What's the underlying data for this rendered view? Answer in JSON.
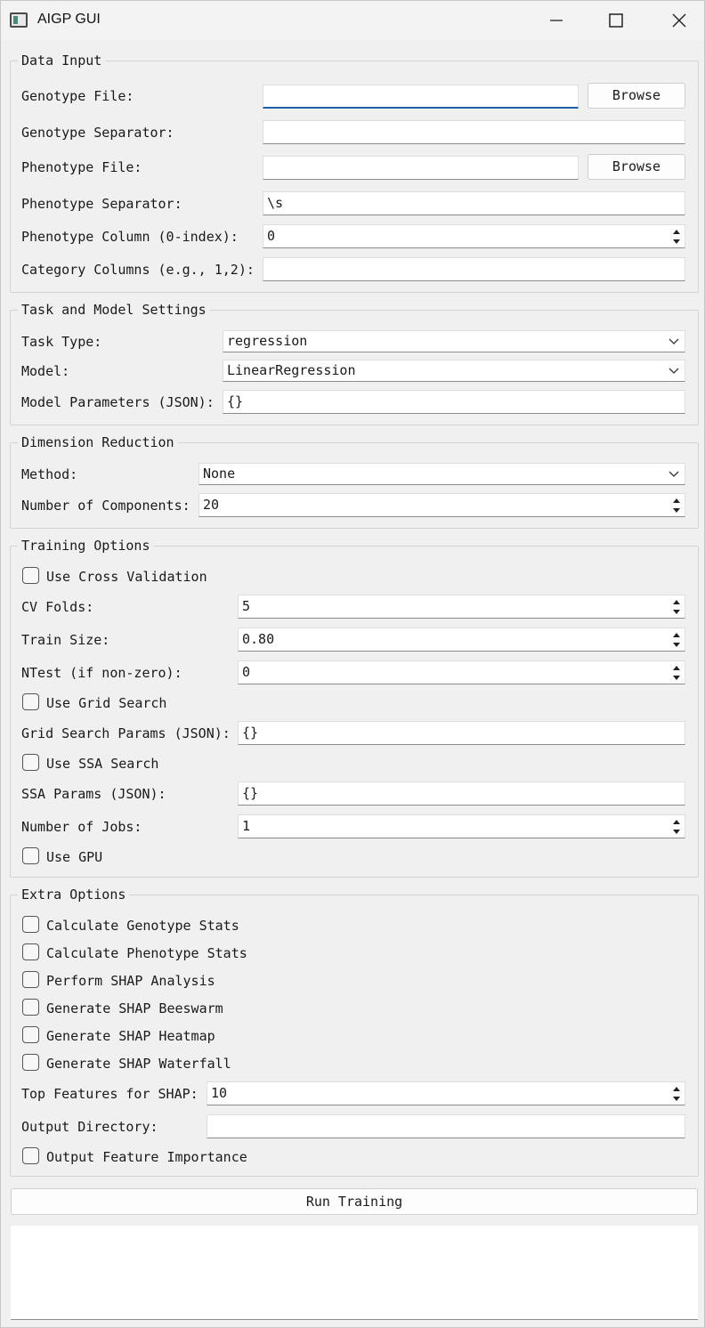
{
  "window": {
    "title": "AIGP GUI"
  },
  "data_input": {
    "title": "Data Input",
    "genotype_file_label": "Genotype File:",
    "genotype_file_value": "",
    "browse_label": "Browse",
    "genotype_sep_label": "Genotype Separator:",
    "genotype_sep_value": "",
    "phenotype_file_label": "Phenotype File:",
    "phenotype_file_value": "",
    "phenotype_sep_label": "Phenotype Separator:",
    "phenotype_sep_value": "\\s",
    "phenotype_col_label": "Phenotype Column (0-index):",
    "phenotype_col_value": "0",
    "category_cols_label": "Category Columns (e.g., 1,2):",
    "category_cols_value": ""
  },
  "task_model": {
    "title": "Task and Model Settings",
    "task_type_label": "Task Type:",
    "task_type_value": "regression",
    "model_label": "Model:",
    "model_value": "LinearRegression",
    "params_label": "Model Parameters (JSON):",
    "params_value": "{}"
  },
  "dim_reduction": {
    "title": "Dimension Reduction",
    "method_label": "Method:",
    "method_value": "None",
    "components_label": "Number of Components:",
    "components_value": "20"
  },
  "training": {
    "title": "Training Options",
    "use_cv_label": "Use Cross Validation",
    "use_cv_checked": false,
    "cv_folds_label": "CV Folds:",
    "cv_folds_value": "5",
    "train_size_label": "Train Size:",
    "train_size_value": "0.80",
    "ntest_label": "NTest (if non-zero):",
    "ntest_value": "0",
    "use_grid_label": "Use Grid Search",
    "use_grid_checked": false,
    "grid_params_label": "Grid Search Params (JSON):",
    "grid_params_value": "{}",
    "use_ssa_label": "Use SSA Search",
    "use_ssa_checked": false,
    "ssa_params_label": "SSA Params (JSON):",
    "ssa_params_value": "{}",
    "jobs_label": "Number of Jobs:",
    "jobs_value": "1",
    "use_gpu_label": "Use GPU",
    "use_gpu_checked": false
  },
  "extra": {
    "title": "Extra Options",
    "geno_stats_label": "Calculate Genotype Stats",
    "pheno_stats_label": "Calculate Phenotype Stats",
    "shap_label": "Perform SHAP Analysis",
    "beeswarm_label": "Generate SHAP Beeswarm",
    "heatmap_label": "Generate SHAP Heatmap",
    "waterfall_label": "Generate SHAP Waterfall",
    "top_features_label": "Top Features for SHAP:",
    "top_features_value": "10",
    "output_dir_label": "Output Directory:",
    "output_dir_value": "",
    "feature_importance_label": "Output Feature Importance"
  },
  "run_button_label": "Run Training",
  "output_log": ""
}
